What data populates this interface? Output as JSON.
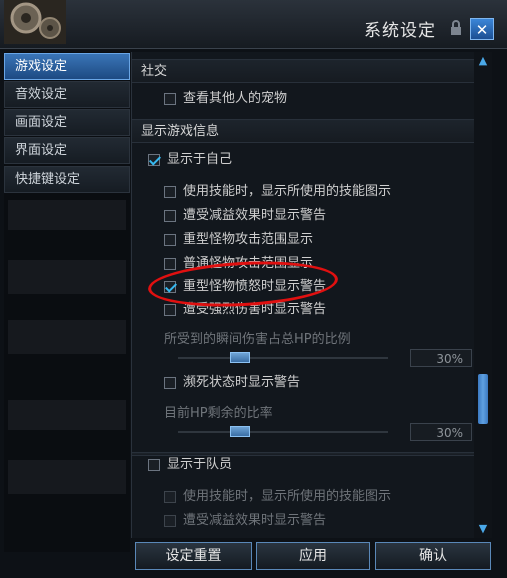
{
  "window": {
    "title": "系统设定",
    "close_label": "✕"
  },
  "tabs": [
    {
      "label": "游戏设定",
      "active": true
    },
    {
      "label": "音效设定",
      "active": false
    },
    {
      "label": "画面设定",
      "active": false
    },
    {
      "label": "界面设定",
      "active": false
    },
    {
      "label": "快捷键设定",
      "active": false
    }
  ],
  "sections": {
    "social": "社交",
    "display_info": "显示游戏信息"
  },
  "options": {
    "view_pets": "查看其他人的宠物",
    "show_self": "显示于自己",
    "skill_icon": "使用技能时，显示所使用的技能图示",
    "debuff_warning": "遭受减益效果时显示警告",
    "heavy_attack_range": "重型怪物攻击范围显示",
    "normal_attack_range": "普通怪物攻击范围显示",
    "heavy_rage_warning": "重型怪物愤怒时显示警告",
    "strong_damage_warning": "遭受强烈伤害时显示警告",
    "damage_ratio_label": "所受到的瞬间伤害占总HP的比例",
    "damage_ratio_value": "30%",
    "near_death_warning": "濒死状态时显示警告",
    "hp_ratio_label": "目前HP剩余的比率",
    "hp_ratio_value": "30%",
    "show_party": "显示于队员",
    "party_skill_icon": "使用技能时，显示所使用的技能图示",
    "party_debuff_warning": "遭受减益效果时显示警告"
  },
  "buttons": {
    "reset": "设定重置",
    "apply": "应用",
    "confirm": "确认"
  },
  "colors": {
    "accent": "#3a75b7",
    "check": "#36b9f0",
    "annotation": "#e01010"
  }
}
